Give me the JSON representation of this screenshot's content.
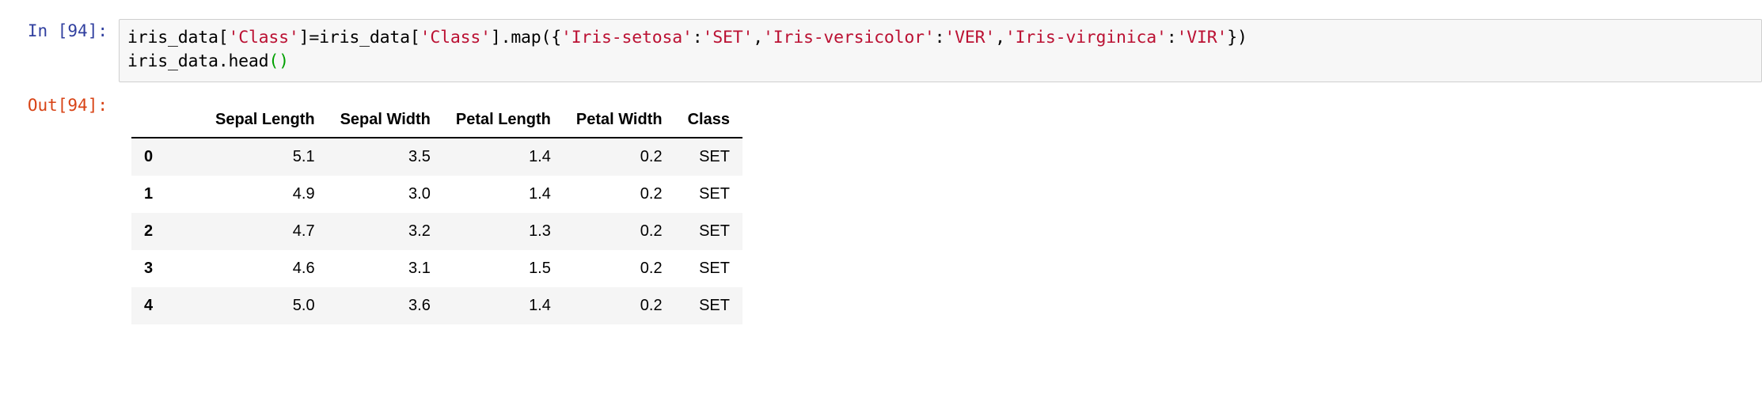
{
  "cell": {
    "input_prompt": "In [94]:",
    "output_prompt": "Out[94]:",
    "code_lines": [
      {
        "tokens": [
          {
            "t": "iris_data[",
            "k": "plain"
          },
          {
            "t": "'Class'",
            "k": "str"
          },
          {
            "t": "]=iris_data[",
            "k": "plain"
          },
          {
            "t": "'Class'",
            "k": "str"
          },
          {
            "t": "].map({",
            "k": "plain"
          },
          {
            "t": "'Iris-setosa'",
            "k": "str"
          },
          {
            "t": ":",
            "k": "plain"
          },
          {
            "t": "'SET'",
            "k": "str"
          },
          {
            "t": ",",
            "k": "plain"
          },
          {
            "t": "'Iris-versicolor'",
            "k": "str"
          },
          {
            "t": ":",
            "k": "plain"
          },
          {
            "t": "'VER'",
            "k": "str"
          },
          {
            "t": ",",
            "k": "plain"
          },
          {
            "t": "'Iris-virginica'",
            "k": "str"
          },
          {
            "t": ":",
            "k": "plain"
          },
          {
            "t": "'VIR'",
            "k": "str"
          },
          {
            "t": "})",
            "k": "plain"
          }
        ]
      },
      {
        "tokens": [
          {
            "t": "iris_data.head",
            "k": "plain"
          },
          {
            "t": "()",
            "k": "fn"
          }
        ]
      }
    ]
  },
  "dataframe": {
    "index_header": "",
    "columns": [
      "Sepal Length",
      "Sepal Width",
      "Petal Length",
      "Petal Width",
      "Class"
    ],
    "rows": [
      {
        "index": "0",
        "cells": [
          "5.1",
          "3.5",
          "1.4",
          "0.2",
          "SET"
        ]
      },
      {
        "index": "1",
        "cells": [
          "4.9",
          "3.0",
          "1.4",
          "0.2",
          "SET"
        ]
      },
      {
        "index": "2",
        "cells": [
          "4.7",
          "3.2",
          "1.3",
          "0.2",
          "SET"
        ]
      },
      {
        "index": "3",
        "cells": [
          "4.6",
          "3.1",
          "1.5",
          "0.2",
          "SET"
        ]
      },
      {
        "index": "4",
        "cells": [
          "5.0",
          "3.6",
          "1.4",
          "0.2",
          "SET"
        ]
      }
    ]
  },
  "colors": {
    "in_prompt": "#303f9f",
    "out_prompt": "#d84315",
    "string_literal": "#bb1133",
    "function_paren": "#00a000",
    "code_background": "#f7f7f7",
    "row_stripe": "#f5f5f5"
  }
}
